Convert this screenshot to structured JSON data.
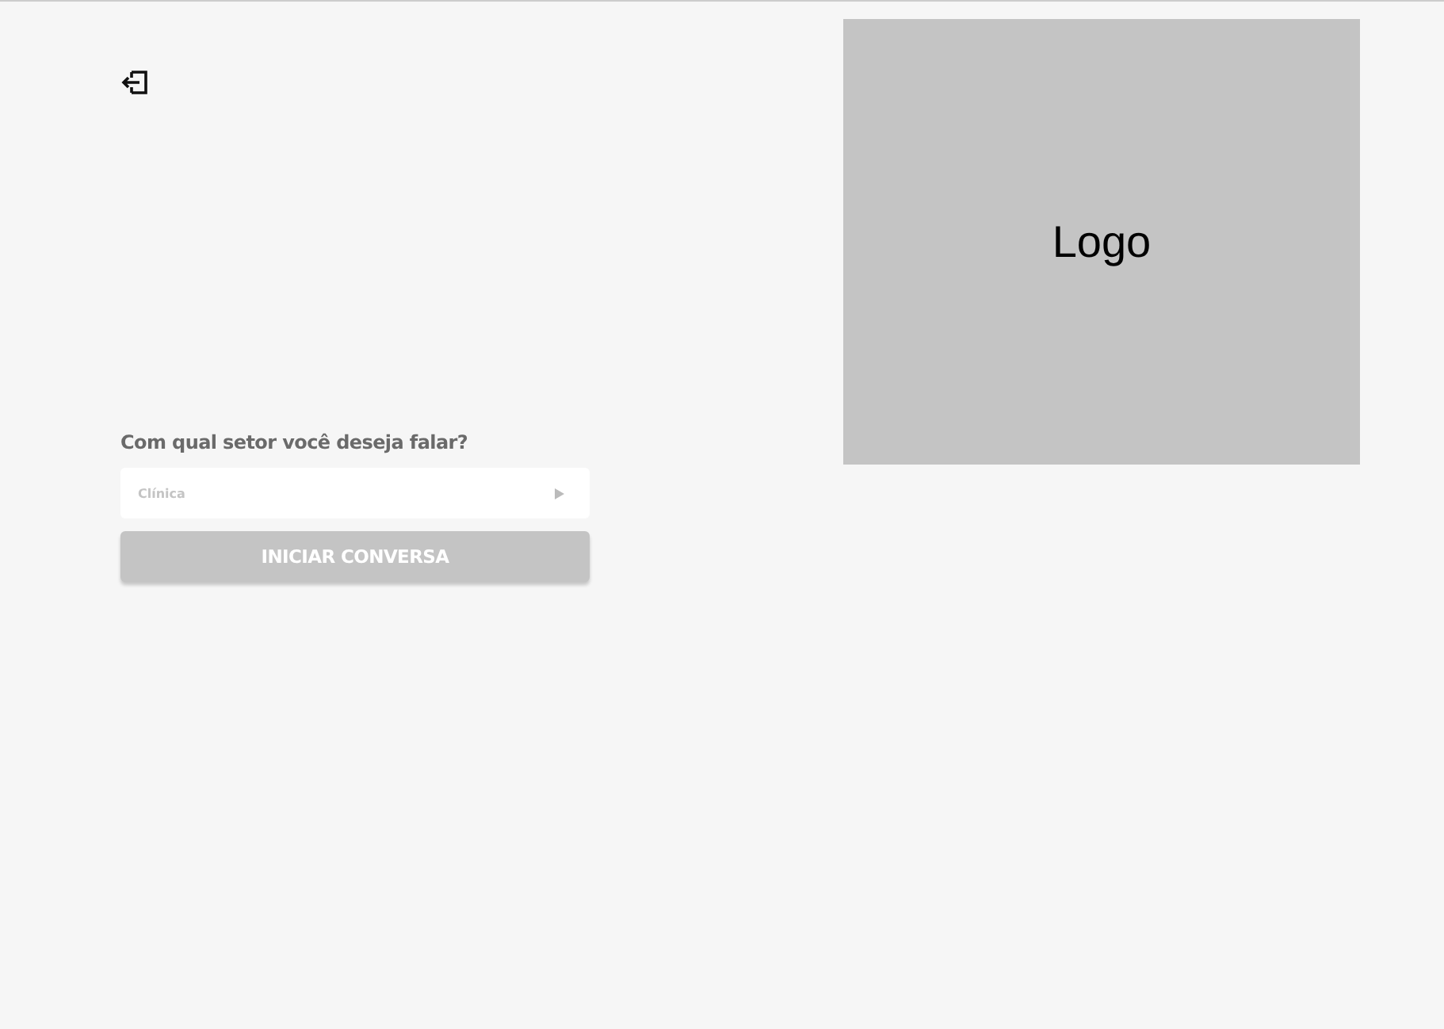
{
  "logo": {
    "label": "Logo"
  },
  "form": {
    "question": "Com qual setor você deseja falar?",
    "select": {
      "value": "Clínica"
    },
    "button": {
      "label": "INICIAR CONVERSA",
      "disabled": true
    }
  }
}
